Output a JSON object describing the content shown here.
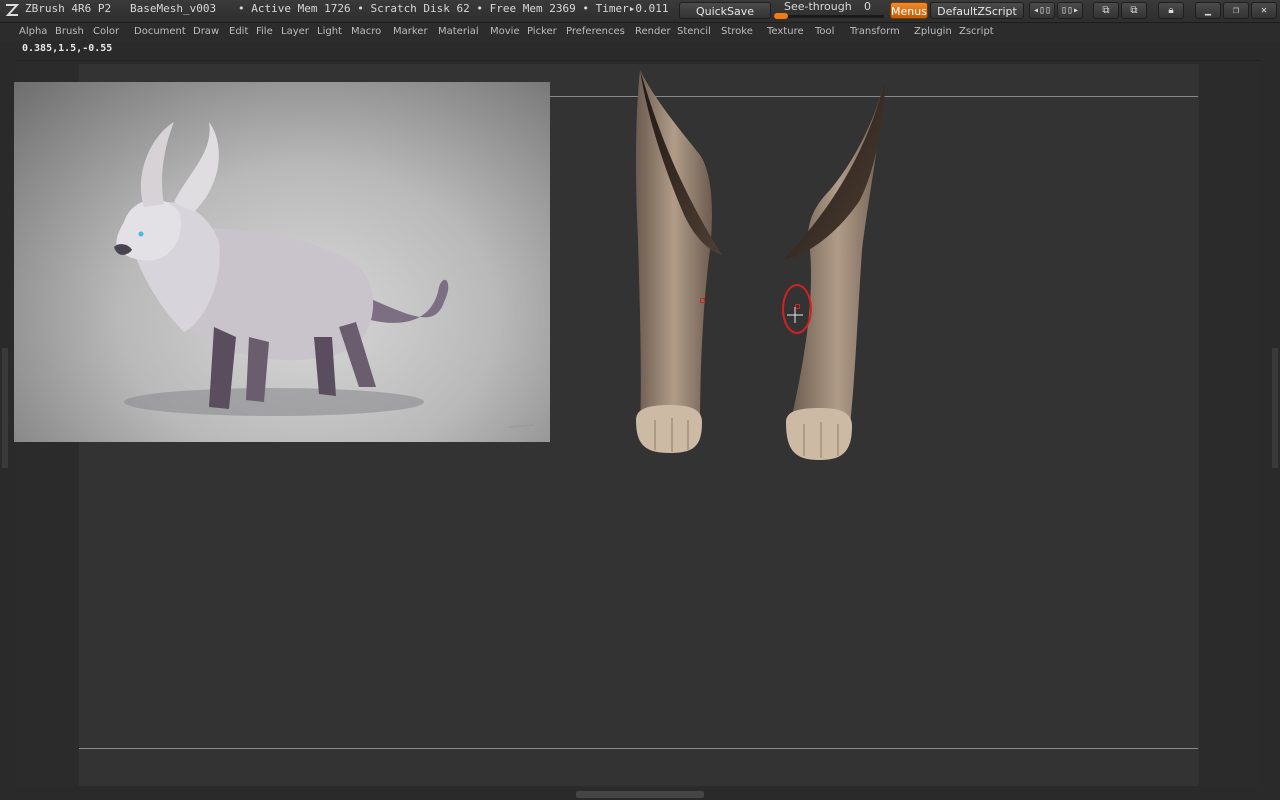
{
  "titlebar": {
    "app": "ZBrush 4R6 P2",
    "document": "BaseMesh_v003",
    "status": "• Active Mem 1726 • Scratch Disk 62 • Free Mem 2369 • Timer▸0.011"
  },
  "toolbar": {
    "quicksave": "QuickSave",
    "see_through_label": "See-through",
    "see_through_value": "0",
    "menus": "Menus",
    "default_zscript": "DefaultZScript",
    "see_through_level": 0
  },
  "menu": [
    "Alpha",
    "Brush",
    "Color",
    "Document",
    "Draw",
    "Edit",
    "File",
    "Layer",
    "Light",
    "Macro",
    "Marker",
    "Material",
    "Movie",
    "Picker",
    "Preferences",
    "Render",
    "Stencil",
    "Stroke",
    "Texture",
    "Tool",
    "Transform",
    "Zplugin",
    "Zscript"
  ],
  "coords": "0.385,1.5,-0.55",
  "colors": {
    "accent": "#f07a14",
    "cursor": "#d42020",
    "canvas": "#333333",
    "skin": "#a38f7d"
  },
  "icons": {
    "logo": "zbrush-logo-icon",
    "close": "close-icon",
    "minimize": "minimize-icon",
    "restore": "restore-icon",
    "lock": "lock-icon"
  }
}
